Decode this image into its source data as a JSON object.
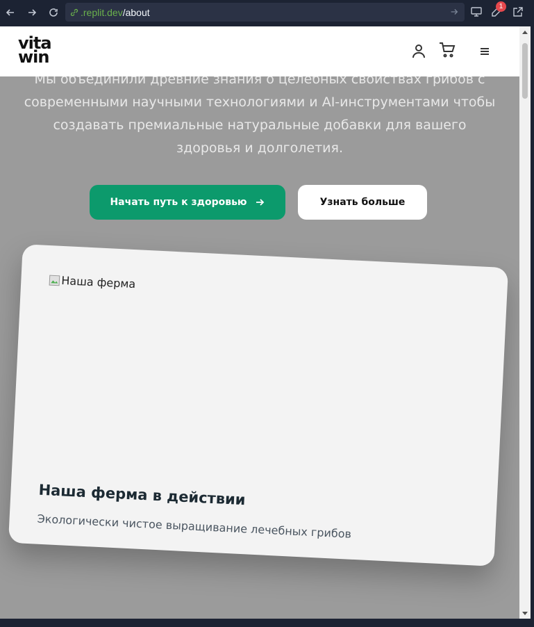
{
  "browser": {
    "url_domain": ".replit.dev",
    "url_path": "/about",
    "notification_count": "1"
  },
  "header": {
    "logo_line1": "vita",
    "logo_line2": "win",
    "icons": [
      "user-icon",
      "cart-icon",
      "menu-icon"
    ]
  },
  "hero": {
    "text": "Мы объединили древние знания о целебных свойствах грибов с современными научными технологиями и AI-инструментами чтобы создавать премиальные натуральные добавки для вашего здоровья и долголетия.",
    "primary_button": "Начать путь к здоровью",
    "secondary_button": "Узнать больше",
    "primary_color": "#0c9a6c"
  },
  "card": {
    "image_alt": "Наша ферма",
    "title": "Наша ферма в действии",
    "subtitle": "Экологически чистое выращивание лечебных грибов"
  }
}
